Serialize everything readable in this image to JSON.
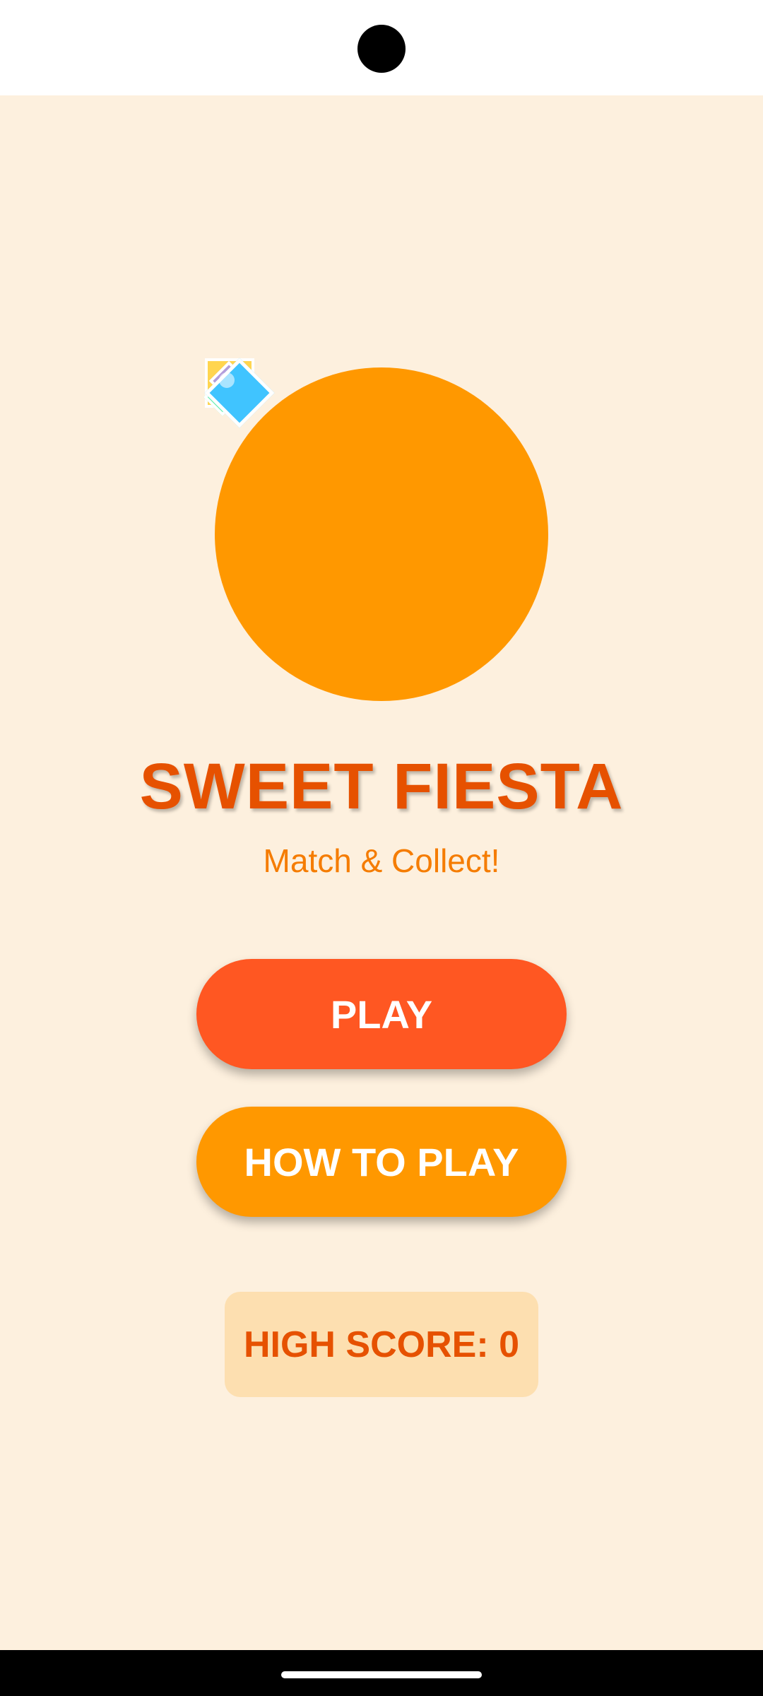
{
  "app": {
    "title": "SWEET FIESTA",
    "subtitle": "Match & Collect!"
  },
  "buttons": {
    "play_label": "PLAY",
    "how_to_play_label": "HOW TO PLAY"
  },
  "high_score": {
    "text": "HIGH SCORE: 0",
    "value": 0
  },
  "icons": {
    "logo": "orange-circle-logo",
    "candies": [
      "yellow-square-candy",
      "green-diamond-candy",
      "purple-diamond-candy",
      "blue-diamond-candy"
    ]
  },
  "colors": {
    "background": "#FDF0DE",
    "title": "#E65100",
    "subtitle": "#F57C00",
    "logo_circle": "#FF9800",
    "play_button": "#FF5722",
    "how_to_play_button": "#FF9800",
    "high_score_box": "#FDDFB0",
    "button_text": "#FFFFFF"
  }
}
